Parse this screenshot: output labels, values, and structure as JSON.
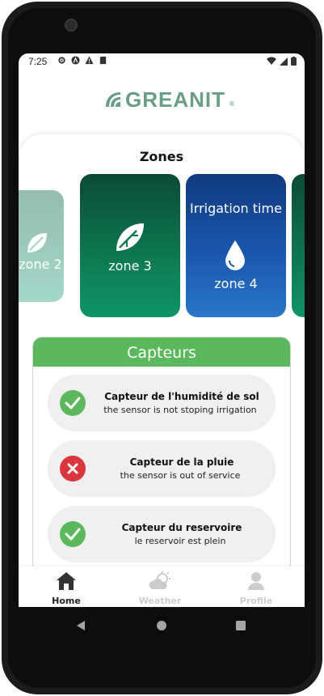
{
  "status_bar": {
    "time": "7:25"
  },
  "brand": {
    "name": "GREANIT",
    "reg_mark": "®"
  },
  "zones": {
    "title": "Zones",
    "cards": [
      {
        "label": "zone 2",
        "color": "#9ad4c4"
      },
      {
        "label": "zone 3",
        "color": "#0d7a52"
      },
      {
        "label": "zone 4",
        "status": "Irrigation time",
        "color": "#1a56ad"
      }
    ]
  },
  "capteurs": {
    "title": "Capteurs",
    "sensors": [
      {
        "title": "Capteur de l'humidité de sol",
        "status": "the sensor is not stoping irrigation",
        "state": "ok"
      },
      {
        "title": "Capteur de la pluie",
        "status": "the sensor is out of service",
        "state": "error"
      },
      {
        "title": "Capteur du reservoire",
        "status": "le reservoir est plein",
        "state": "ok"
      }
    ]
  },
  "bottom_nav": {
    "items": [
      {
        "label": "Home",
        "icon": "home-icon",
        "active": true
      },
      {
        "label": "Weather",
        "icon": "weather-icon",
        "active": false
      },
      {
        "label": "Profile",
        "icon": "profile-icon",
        "active": false
      }
    ]
  },
  "colors": {
    "accent_green": "#5cb85c",
    "error_red": "#d9363e",
    "brand_green": "#6a9d85"
  }
}
